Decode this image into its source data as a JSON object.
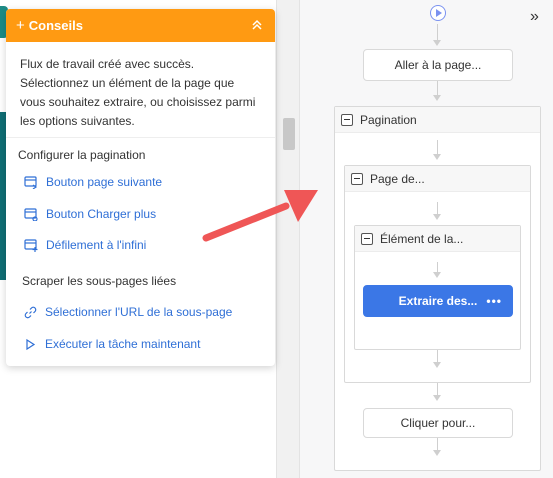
{
  "tips": {
    "title": "Conseils",
    "message": "Flux de travail créé avec succès. Sélectionnez un élément de la page que vous souhaitez extraire, ou choisissez parmi les options suivantes.",
    "section_pagination": "Configurer la pagination",
    "items_pagination": [
      {
        "label": "Bouton page suivante",
        "icon": "next-page-icon"
      },
      {
        "label": "Bouton Charger plus",
        "icon": "load-more-icon"
      },
      {
        "label": "Défilement à l'infini",
        "icon": "infinite-scroll-icon"
      }
    ],
    "section_subpages": "Scraper les sous-pages liées",
    "items_subpages": [
      {
        "label": "Sélectionner l'URL de la sous-page",
        "icon": "link-icon"
      },
      {
        "label": "Exécuter la tâche maintenant",
        "icon": "play-icon"
      }
    ]
  },
  "flow": {
    "goto_page": "Aller à la page...",
    "pagination": "Pagination",
    "page_of": "Page de...",
    "element_of": "Élément de la...",
    "extract": "Extraire des...",
    "click_for": "Cliquer pour..."
  },
  "colors": {
    "tips_header": "#ff9a12",
    "link": "#2f6fd6",
    "extract_node": "#3b77e6",
    "arrow": "#ef5656"
  }
}
